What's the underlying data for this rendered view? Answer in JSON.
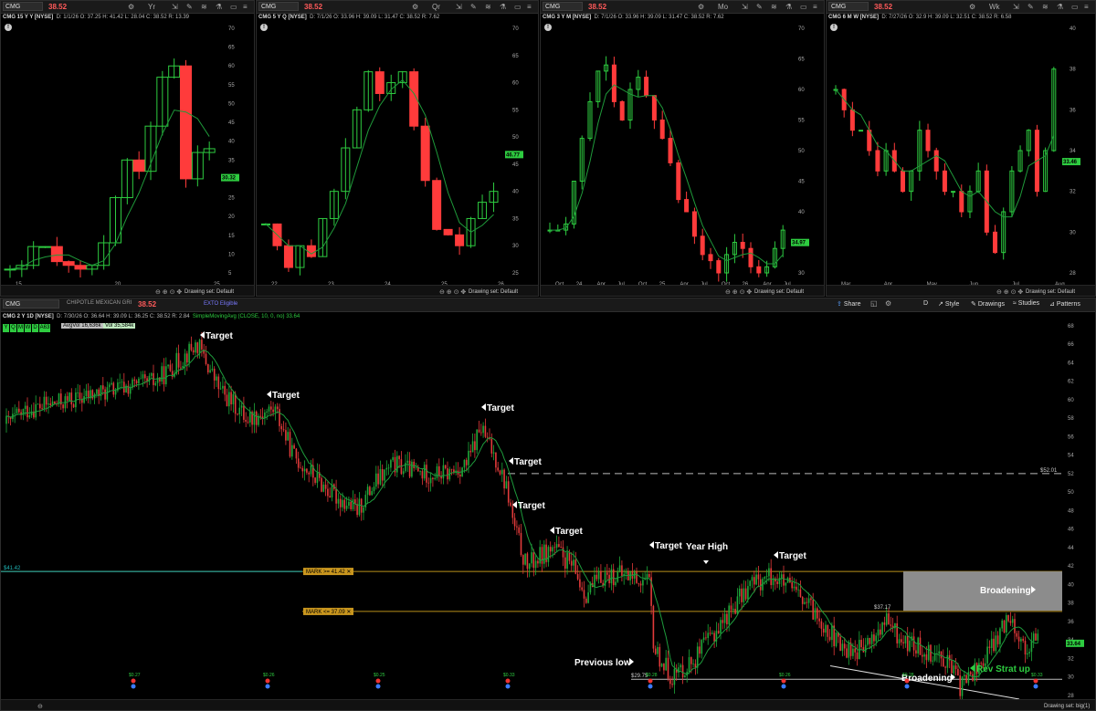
{
  "symbol": "CMG",
  "last_price": "38.52",
  "company_name": "CHIPOTLE MEXICAN GRI",
  "etb_label": "EXTO Eligible",
  "top_charts": [
    {
      "title": "CMG 15 Y Y [NYSE]",
      "ohlc": "D: 1/1/26  O: 37.25  H: 41.42  L: 28.04  C: 38.52  R: 13.39",
      "timeframe": "Yr",
      "price_tag": "30.32",
      "x_ticks": [
        "15",
        "20",
        "25"
      ],
      "y_ticks": [
        "70",
        "65",
        "60",
        "55",
        "50",
        "45",
        "40",
        "35",
        "30",
        "25",
        "20",
        "15",
        "10",
        "5"
      ]
    },
    {
      "title": "CMG 5 Y Q [NYSE]",
      "ohlc": "D: 7/1/26  O: 33.96  H: 39.09  L: 31.47  C: 38.52  R: 7.62",
      "timeframe": "Qr",
      "price_tag": "46.77",
      "x_ticks": [
        "22",
        "23",
        "24",
        "25",
        "26"
      ],
      "y_ticks": [
        "70",
        "65",
        "60",
        "55",
        "50",
        "45",
        "40",
        "35",
        "30",
        "25"
      ]
    },
    {
      "title": "CMG 3 Y M [NYSE]",
      "ohlc": "D: 7/1/26  O: 33.96  H: 39.09  L: 31.47  C: 38.52  R: 7.62",
      "timeframe": "Mo",
      "price_tag": "34.97",
      "x_ticks": [
        "Oct",
        "24",
        "Apr",
        "Jul",
        "Oct",
        "25",
        "Apr",
        "Jul",
        "Oct",
        "26",
        "Apr",
        "Jul"
      ],
      "y_ticks": [
        "70",
        "65",
        "60",
        "55",
        "50",
        "45",
        "40",
        "35",
        "30"
      ]
    },
    {
      "title": "CMG 6 M W [NYSE]",
      "ohlc": "D: 7/27/26  O: 32.9  H: 39.09  L: 32.51  C: 38.52  R: 6.58",
      "timeframe": "Wk",
      "price_tag": "33.46",
      "x_ticks": [
        "Mar",
        "Apr",
        "May",
        "Jun",
        "Jul",
        "Aug"
      ],
      "y_ticks": [
        "40",
        "38",
        "36",
        "34",
        "32",
        "30",
        "28"
      ]
    }
  ],
  "drawing_set_label": "Drawing set: Default",
  "main_chart": {
    "title": "CMG 2 Y 1D [NYSE]",
    "ohlc": "D: 7/30/26  O: 36.64  H: 39.09  L: 36.25  C: 38.52  R: 2.84",
    "study": "SimpleMovingAvg (CLOSE, 10, 0, no)",
    "study_value": "33.64",
    "avg_vol": "AvgVol 16,636k",
    "vol": "Vol 35,584k",
    "periods": [
      "Y",
      "Q",
      "M",
      "W",
      "D",
      "A63"
    ],
    "price_tag": "33.64",
    "drawing_set_label": "Drawing set: big(1)",
    "toolbar": {
      "share": "Share",
      "d": "D",
      "style": "Style",
      "drawings": "Drawings",
      "studies": "Studies",
      "patterns": "Patterns"
    },
    "x_ticks": [
      "Aug",
      "Sep",
      "Oct",
      "Nov",
      "Dec",
      "25",
      "Feb",
      "Mar",
      "Apr",
      "May",
      "Jun",
      "Jul",
      "Aug",
      "Sep",
      "Oct",
      "Nov",
      "Dec",
      "26",
      "Feb",
      "Mar",
      "Apr",
      "May",
      "Jun",
      "Jul",
      "Aug"
    ],
    "y_ticks": [
      "68",
      "66",
      "64",
      "62",
      "60",
      "58",
      "56",
      "54",
      "52",
      "50",
      "48",
      "46",
      "44",
      "42",
      "40",
      "38",
      "36",
      "34",
      "32",
      "30",
      "28"
    ],
    "left_price_line": "$41.42",
    "mark_high": "MARK >= 41.42 ✕",
    "mark_low": "MARK <= 37.09 ✕",
    "level_52": "$52.01",
    "level_37": "$37.17",
    "level_30": "$29.75",
    "annotations": {
      "target": "Target",
      "year_high": "Year High",
      "previous_low": "Previous low",
      "broadening": "Broadening",
      "rev_strat": "Rev Strat up"
    },
    "dividends": [
      "$0.27",
      "$0.26",
      "$0.25",
      "$0.33",
      "$0.28",
      "$0.26",
      "$0.28",
      "$0.33"
    ]
  }
}
